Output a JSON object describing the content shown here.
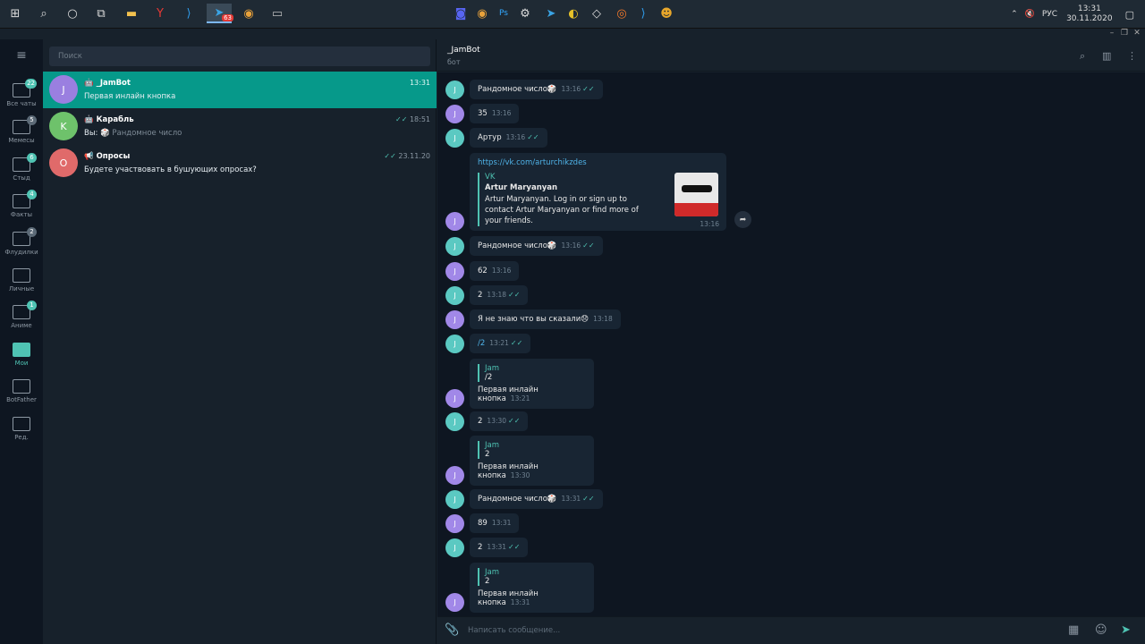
{
  "taskbar": {
    "lang": "РУС",
    "time": "13:31",
    "date": "30.11.2020",
    "telegram_badge": "63"
  },
  "folders": [
    {
      "label": "Все чаты",
      "badge": "22",
      "hl": true
    },
    {
      "label": "Мемесы",
      "badge": "5",
      "hl": false
    },
    {
      "label": "Стыд",
      "badge": "6",
      "hl": true
    },
    {
      "label": "Факты",
      "badge": "4",
      "hl": true
    },
    {
      "label": "Флудилки",
      "badge": "2",
      "hl": false
    },
    {
      "label": "Личные",
      "badge": "",
      "hl": false
    },
    {
      "label": "Аниме",
      "badge": "1",
      "hl": true
    },
    {
      "label": "Мои",
      "badge": "",
      "hl": false
    },
    {
      "label": "BotFather",
      "badge": "",
      "hl": false
    },
    {
      "label": "Ред.",
      "badge": "",
      "hl": false
    }
  ],
  "search": {
    "placeholder": "Поиск"
  },
  "chats": [
    {
      "avatar": "J",
      "color": "#9a7fe0",
      "name": "_JamBot",
      "msg": "Первая инлайн кнопка",
      "time": "13:31",
      "selected": true
    },
    {
      "avatar": "K",
      "color": "#6ec26b",
      "name": "Карабль",
      "msg_prefix": "Вы:",
      "msg": "Рандомное число",
      "time": "18:51"
    },
    {
      "avatar": "O",
      "color": "#e06a6a",
      "name": "Опросы",
      "msg": "Будете участвовать в бушующих опросах?",
      "time": "23.11.20"
    }
  ],
  "header": {
    "name": "_JamBot",
    "sub": "бот"
  },
  "link_preview": {
    "url": "https://vk.com/arturchikzdes",
    "site": "VK",
    "title": "Artur Maryanyan",
    "desc": "Artur Maryanyan. Log in or sign up to contact Artur Maryanyan or find more of your friends.",
    "time": "13:16"
  },
  "messages": [
    {
      "text": "Рандомное число🎲",
      "time": "13:16",
      "check": true,
      "av": "J",
      "c": "#5bc9c2"
    },
    {
      "text": "35",
      "time": "13:16",
      "check": false,
      "av": "J",
      "c": "#a188e8"
    },
    {
      "text": "Артур",
      "time": "13:16",
      "check": true,
      "av": "J",
      "c": "#5bc9c2"
    },
    {
      "text": "Рандомное число🎲",
      "time": "13:16",
      "check": true,
      "av": "J",
      "c": "#5bc9c2"
    },
    {
      "text": "62",
      "time": "13:16",
      "check": false,
      "av": "J",
      "c": "#a188e8"
    },
    {
      "text": "2",
      "time": "13:18",
      "check": true,
      "av": "J",
      "c": "#5bc9c2"
    },
    {
      "text": "Я не знаю что вы сказали😞",
      "time": "13:18",
      "check": false,
      "av": "J",
      "c": "#a188e8"
    },
    {
      "text": "/2",
      "time": "13:21",
      "check": true,
      "av": "J",
      "c": "#5bc9c2",
      "link": true
    },
    {
      "reply_name": "Jam",
      "reply_text": "/2",
      "text": "Первая инлайн кнопка",
      "time": "13:21",
      "check": false,
      "av": "J",
      "c": "#a188e8"
    },
    {
      "text": "2",
      "time": "13:30",
      "check": true,
      "av": "J",
      "c": "#5bc9c2"
    },
    {
      "reply_name": "Jam",
      "reply_text": "2",
      "text": "Первая инлайн кнопка",
      "time": "13:30",
      "check": false,
      "av": "J",
      "c": "#a188e8"
    },
    {
      "text": "Рандомное число🎲",
      "time": "13:31",
      "check": true,
      "av": "J",
      "c": "#5bc9c2"
    },
    {
      "text": "89",
      "time": "13:31",
      "check": false,
      "av": "J",
      "c": "#a188e8"
    },
    {
      "text": "2",
      "time": "13:31",
      "check": true,
      "av": "J",
      "c": "#5bc9c2"
    },
    {
      "reply_name": "Jam",
      "reply_text": "2",
      "text": "Первая инлайн кнопка",
      "time": "13:31",
      "check": false,
      "av": "J",
      "c": "#a188e8"
    }
  ],
  "composer": {
    "placeholder": "Написать сообщение..."
  }
}
